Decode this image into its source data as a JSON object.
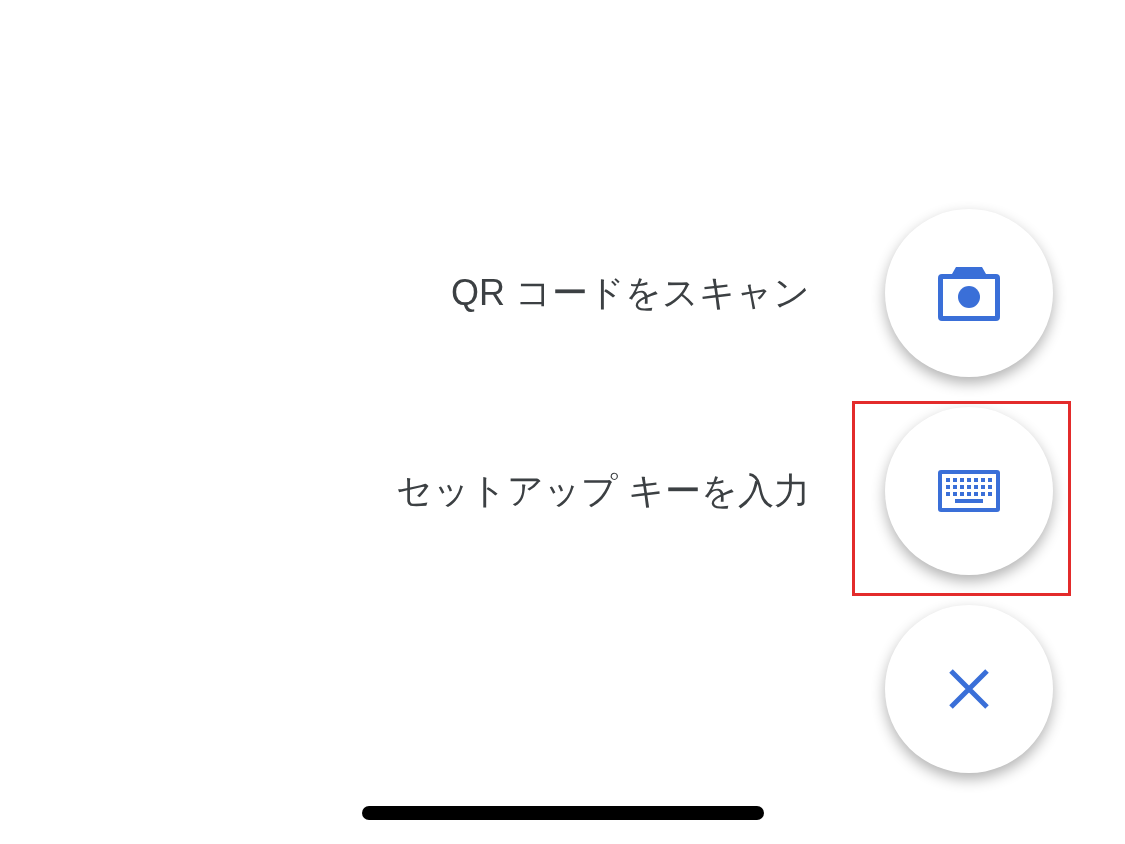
{
  "actions": [
    {
      "kind": "camera",
      "label": "QR コードをスキャン",
      "highlighted": false
    },
    {
      "kind": "keyboard",
      "label": "セットアップ キーを入力",
      "highlighted": true
    },
    {
      "kind": "close",
      "highlighted": false
    }
  ]
}
